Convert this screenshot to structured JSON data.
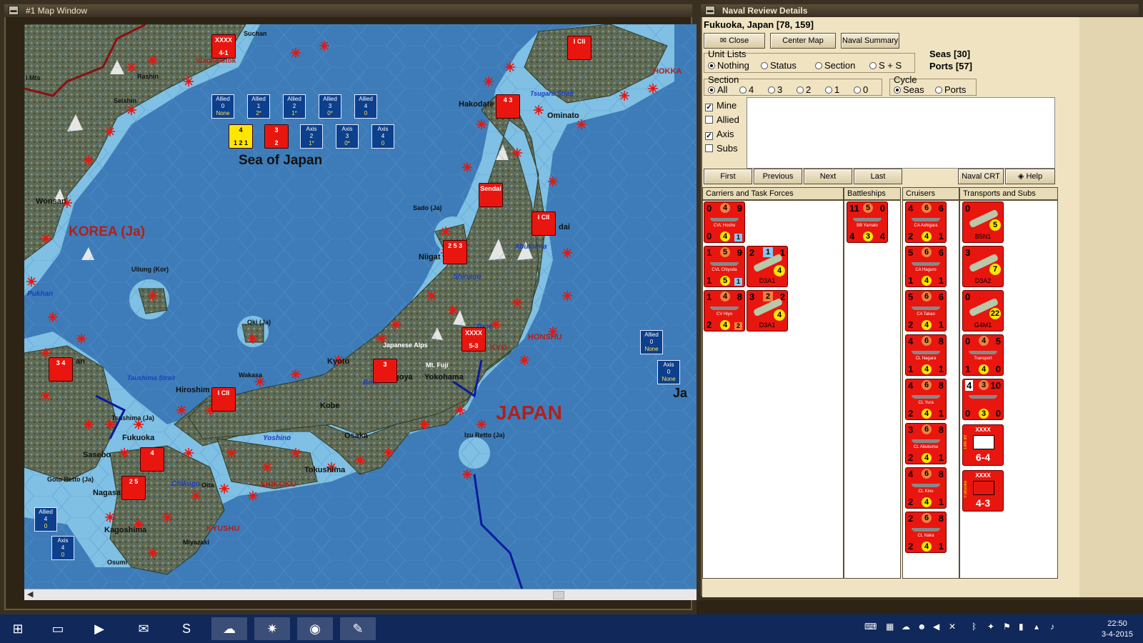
{
  "map_window": {
    "title": "#1 Map Window",
    "labels": {
      "sea_of_japan": "Sea of Japan",
      "korea": "KOREA (Ja)",
      "japan": "JAPAN",
      "honshu": "HONSHU",
      "shikoku": "SHIKOKU",
      "kyushu": "KYUSHU",
      "hokkaido": "HOKKA",
      "suchan": "Suchan",
      "vladivostok": "Vladivostok",
      "rashin": "Rashin",
      "seishin": "Seishin",
      "mts": "i Mts",
      "wonsan": "Wonsan",
      "hakodate": "Hakodate",
      "tsugaru": "Tsugaru Strait",
      "ominato": "Ominato",
      "sado": "Sado (Ja)",
      "niigata": "Niigat",
      "dai": "dai",
      "abukuma": "Abukuma",
      "shinano": "Shinano",
      "ullung": "Ullung (Kor)",
      "pukhan": "Pukhan",
      "oki": "Oki (Ja)",
      "japanese_alps": "Japanese Alps",
      "tone": "Tone",
      "tokyo": "KYO",
      "kyoto": "Kyoto",
      "yokohama": "Yokohama",
      "mt_fuji": "Mt. Fuji",
      "nagoya": "goya",
      "biwa": "Biwa",
      "wakasa": "Wakasa",
      "hiroshima": "Hiroshim",
      "kobe": "Kobe",
      "osaka": "Osaka",
      "yoshino": "Yoshino",
      "tokushima": "Tokushima",
      "izu": "Izu Retto (Ja)",
      "tsushima_strait": "Taushima Strait",
      "tsushima": "Tsushima (Ja)",
      "fukuoka": "Fukuoka",
      "sasebo": "Sasebo",
      "goto": "Goto Retto (Ja)",
      "nagasa": "Nagasa",
      "chikugo": "Chikugo",
      "oita": "Oita",
      "kagoshima": "Kagoshima",
      "miyazaki": "Miyazaki",
      "osumi": "Osumi",
      "busan": "an",
      "ja_right": "Ja"
    },
    "status_boxes_top": [
      {
        "side": "Allied",
        "num": "0",
        "val": "None"
      },
      {
        "side": "Allied",
        "num": "1",
        "val": "2*"
      },
      {
        "side": "Allied",
        "num": "2",
        "val": "1*"
      },
      {
        "side": "Allied",
        "num": "3",
        "val": "0*"
      },
      {
        "side": "Allied",
        "num": "4",
        "val": "0"
      }
    ],
    "status_boxes_axis": [
      {
        "side": "Axis",
        "num": "2",
        "val": "1*"
      },
      {
        "side": "Axis",
        "num": "3",
        "val": "0*"
      },
      {
        "side": "Axis",
        "num": "4",
        "val": "0"
      }
    ],
    "status_boxes_right": [
      {
        "side": "Allied",
        "num": "0",
        "val": "None"
      },
      {
        "side": "Axis",
        "num": "0",
        "val": "None"
      }
    ],
    "status_boxes_bottom": [
      {
        "side": "Allied",
        "num": "4",
        "val": "0"
      },
      {
        "side": "Axis",
        "num": "4",
        "val": "0"
      }
    ],
    "counters": {
      "vladivostok_unit": "4-1",
      "tokyo_unit": "5-3",
      "fleet_counter": "1  2  1",
      "fleet_counter2": "2"
    }
  },
  "naval_window": {
    "title": "Naval Review Details",
    "location": "Fukuoka, Japan [78, 159]",
    "buttons": {
      "close": "Close",
      "center_map": "Center Map",
      "naval_summary": "Naval Summary",
      "first": "First",
      "previous": "Previous",
      "next": "Next",
      "last": "Last",
      "naval_crt": "Naval CRT",
      "help": "Help"
    },
    "unit_lists": {
      "label": "Unit Lists",
      "options": [
        "Nothing",
        "Status",
        "Section",
        "S + S"
      ],
      "selected": "Nothing"
    },
    "counts": {
      "seas": "Seas [30]",
      "ports": "Ports [57]"
    },
    "section": {
      "label": "Section",
      "options": [
        "All",
        "4",
        "3",
        "2",
        "1",
        "0"
      ],
      "selected": "All"
    },
    "cycle": {
      "label": "Cycle",
      "options": [
        "Seas",
        "Ports"
      ],
      "selected": "Seas"
    },
    "filters": [
      {
        "label": "Mine",
        "checked": true
      },
      {
        "label": "Allied",
        "checked": false
      },
      {
        "label": "Axis",
        "checked": true
      },
      {
        "label": "Subs",
        "checked": false
      }
    ],
    "columns": {
      "carriers": "Carriers and Task Forces",
      "battleships": "Battleships",
      "cruisers": "Cruisers",
      "transports": "Transports and Subs"
    },
    "carriers": [
      {
        "tl": "0",
        "tm": "4",
        "tr": "9",
        "bl": "0",
        "bm": "4",
        "br": "1",
        "name": "CVL Hosho"
      },
      {
        "tl": "1",
        "tm": "5",
        "tr": "9",
        "bl": "1",
        "bm": "5",
        "br": "1",
        "name": "CVL Chiyoda"
      },
      {
        "tl": "1",
        "tm": "4",
        "tr": "8",
        "bl": "2",
        "bm": "4",
        "br": "2",
        "name": "CV Hiyo"
      }
    ],
    "carrier_planes": [
      {
        "tl": "2",
        "tm": "1",
        "tr": "1",
        "badge": "4",
        "label": "D3A1"
      },
      {
        "tl": "3",
        "tm": "2",
        "tr": "2",
        "badge": "4",
        "label": "D3A1"
      }
    ],
    "battleships": [
      {
        "tl": "11",
        "tm": "5",
        "tr": "0",
        "bl": "4",
        "bm": "3",
        "br": "4",
        "name": "BB Yamato"
      }
    ],
    "cruisers": [
      {
        "tl": "4",
        "tm": "6",
        "tr": "6",
        "bl": "2",
        "bm": "4",
        "br": "1",
        "name": "CA Ashigara"
      },
      {
        "tl": "5",
        "tm": "6",
        "tr": "6",
        "bl": "1",
        "bm": "4",
        "br": "1",
        "name": "CA Haguro"
      },
      {
        "tl": "5",
        "tm": "6",
        "tr": "6",
        "bl": "2",
        "bm": "4",
        "br": "1",
        "name": "CA Takao"
      },
      {
        "tl": "4",
        "tm": "6",
        "tr": "8",
        "bl": "1",
        "bm": "4",
        "br": "1",
        "name": "CL Nagara"
      },
      {
        "tl": "4",
        "tm": "6",
        "tr": "8",
        "bl": "2",
        "bm": "4",
        "br": "1",
        "name": "CL Yura"
      },
      {
        "tl": "3",
        "tm": "6",
        "tr": "8",
        "bl": "2",
        "bm": "4",
        "br": "1",
        "name": "CL Abukuma"
      },
      {
        "tl": "4",
        "tm": "6",
        "tr": "8",
        "bl": "2",
        "bm": "4",
        "br": "1",
        "name": "CL Kinu"
      },
      {
        "tl": "2",
        "tm": "6",
        "tr": "8",
        "bl": "2",
        "bm": "4",
        "br": "1",
        "name": "CL Naka"
      }
    ],
    "transports": [
      {
        "kind": "plane",
        "tl": "0",
        "badge": "5",
        "label": "B5N1"
      },
      {
        "kind": "plane",
        "tl": "3",
        "badge": "7",
        "label": "D3A2"
      },
      {
        "kind": "plane",
        "tl": "0",
        "badge": "22",
        "label": "G4M1"
      },
      {
        "kind": "ship",
        "tl": "0",
        "tm": "4",
        "tr": "5",
        "bl": "1",
        "bm": "4",
        "br": "0",
        "name": "Transport"
      },
      {
        "kind": "ship",
        "tl": "4",
        "tm": "3",
        "tr": "10",
        "bl": "0",
        "bm": "3",
        "br": "0",
        "name": ""
      },
      {
        "kind": "land",
        "top": "XXXX",
        "side": "14th Inf",
        "big": "6-4"
      },
      {
        "kind": "land",
        "top": "XXXX",
        "side": "Fukuoka",
        "big": "4-3"
      }
    ]
  },
  "taskbar": {
    "time": "22:50",
    "date": "3-4-2015"
  },
  "colors": {
    "sea": "#3d7cb8",
    "unit_red": "#e8160f",
    "panel": "#efe3c2"
  }
}
